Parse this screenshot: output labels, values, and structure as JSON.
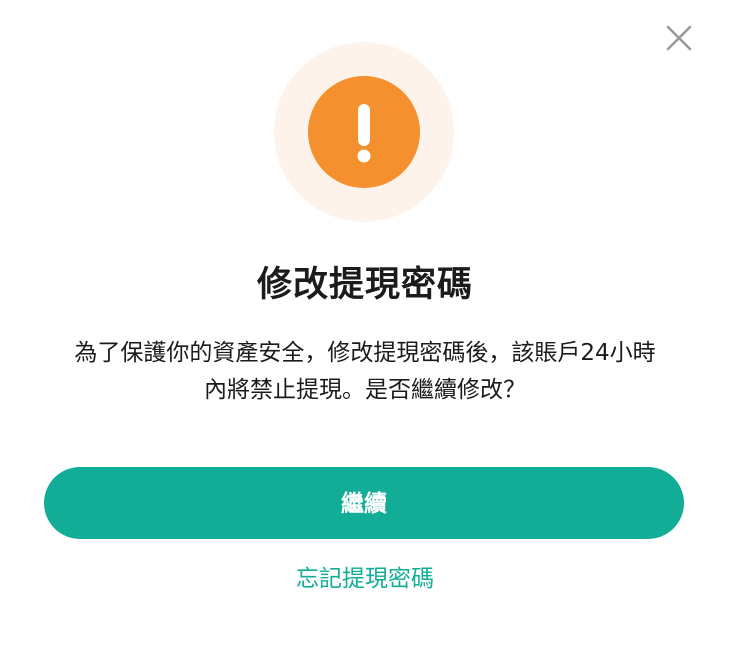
{
  "dialog": {
    "title": "修改提現密碼",
    "message_line1": "為了保護你的資產安全，修改提現密碼後，該賬戶24小時",
    "message_line2": "內將禁止提現。是否繼續修改？",
    "continue_label": "繼續",
    "forgot_label": "忘記提現密碼"
  },
  "icons": {
    "close": "close-icon",
    "alert": "exclamation-icon"
  },
  "colors": {
    "accent": "#11ad97",
    "warning": "#f5902e",
    "warning_halo": "#fef3ea",
    "text": "#1b1b1b",
    "close_icon": "#9a9a9a"
  }
}
